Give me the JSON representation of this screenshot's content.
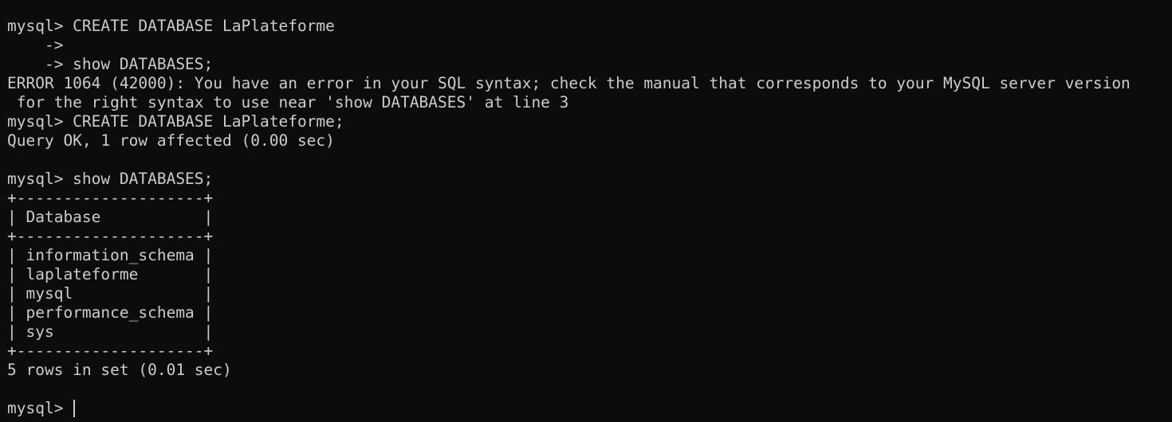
{
  "terminal": {
    "lines": [
      "mysql> CREATE DATABASE LaPlateforme",
      "    ->",
      "    -> show DATABASES;",
      "ERROR 1064 (42000): You have an error in your SQL syntax; check the manual that corresponds to your MySQL server version",
      " for the right syntax to use near 'show DATABASES' at line 3",
      "mysql> CREATE DATABASE LaPlateforme;",
      "Query OK, 1 row affected (0.00 sec)",
      "",
      "mysql> show DATABASES;",
      "+--------------------+",
      "| Database           |",
      "+--------------------+",
      "| information_schema |",
      "| laplateforme       |",
      "| mysql              |",
      "| performance_schema |",
      "| sys                |",
      "+--------------------+",
      "5 rows in set (0.01 sec)",
      ""
    ],
    "prompt": "mysql> "
  },
  "colors": {
    "background": "#0c0c0c",
    "foreground": "#cccccc"
  }
}
